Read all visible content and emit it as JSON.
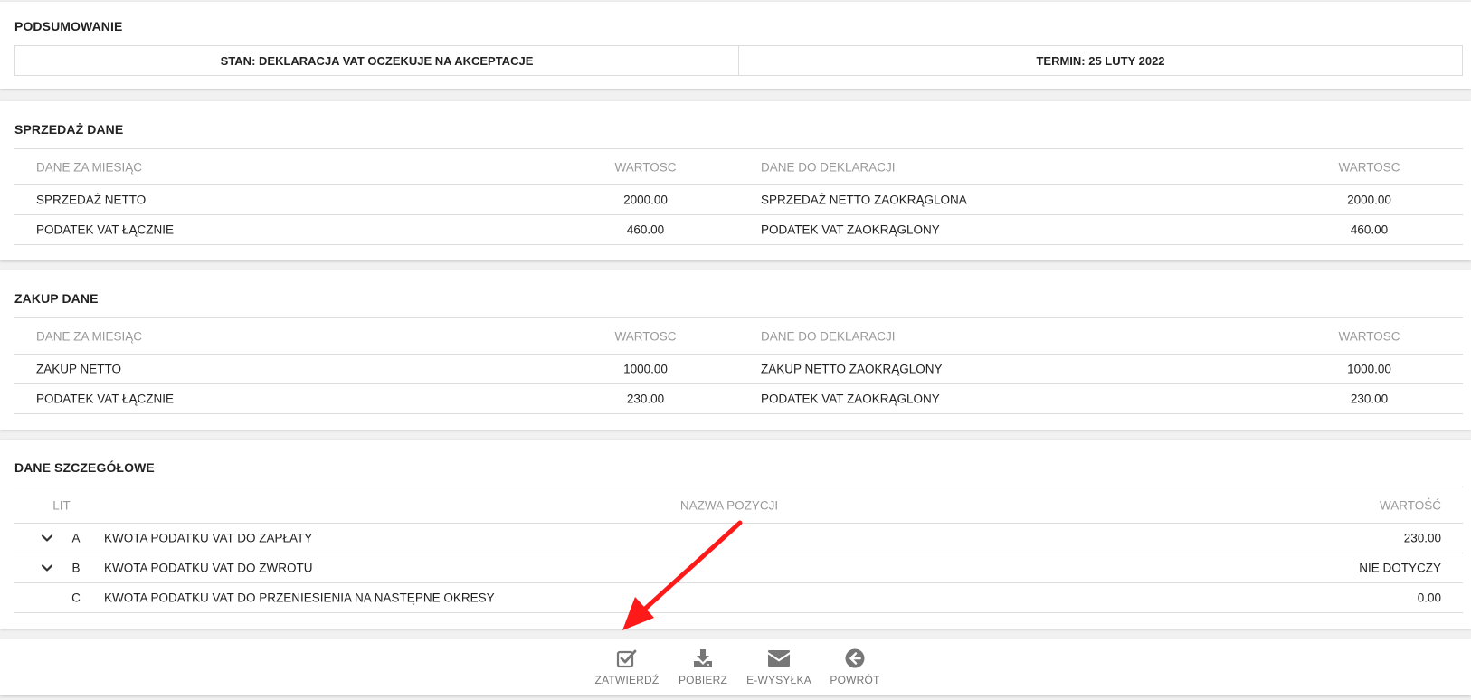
{
  "summary": {
    "title": "PODSUMOWANIE",
    "status": "STAN: DEKLARACJA VAT OCZEKUJE NA AKCEPTACJE",
    "deadline": "TERMIN: 25 LUTY 2022"
  },
  "sales": {
    "title": "SPRZEDAŻ DANE",
    "headers": [
      "DANE ZA MIESIĄC",
      "WARTOSC",
      "DANE DO DEKLARACJI",
      "WARTOSC"
    ],
    "rows": [
      [
        "SPRZEDAŻ NETTO",
        "2000.00",
        "SPRZEDAŻ NETTO ZAOKRĄGLONA",
        "2000.00"
      ],
      [
        "PODATEK VAT ŁĄCZNIE",
        "460.00",
        "PODATEK VAT ZAOKRĄGLONY",
        "460.00"
      ]
    ]
  },
  "purchase": {
    "title": "ZAKUP DANE",
    "headers": [
      "DANE ZA MIESIĄC",
      "WARTOSC",
      "DANE DO DEKLARACJI",
      "WARTOSC"
    ],
    "rows": [
      [
        "ZAKUP NETTO",
        "1000.00",
        "ZAKUP NETTO ZAOKRĄGLONY",
        "1000.00"
      ],
      [
        "PODATEK VAT ŁĄCZNIE",
        "230.00",
        "PODATEK VAT ZAOKRĄGLONY",
        "230.00"
      ]
    ]
  },
  "details": {
    "title": "DANE SZCZEGÓŁOWE",
    "headers": [
      "LIT",
      "NAZWA POZYCJI",
      "WARTOŚĆ"
    ],
    "rows": [
      {
        "lit": "A",
        "name": "KWOTA PODATKU VAT DO ZAPŁATY",
        "value": "230.00",
        "expandable": true
      },
      {
        "lit": "B",
        "name": "KWOTA PODATKU VAT DO ZWROTU",
        "value": "NIE DOTYCZY",
        "expandable": true
      },
      {
        "lit": "C",
        "name": "KWOTA PODATKU VAT DO PRZENIESIENIA NA NASTĘPNE OKRESY",
        "value": "0.00",
        "expandable": false
      }
    ]
  },
  "toolbar": {
    "approve": {
      "label": "ZATWIERDŹ",
      "icon": "check-square-icon"
    },
    "download": {
      "label": "POBIERZ",
      "icon": "download-icon"
    },
    "send": {
      "label": "E-WYSYŁKA",
      "icon": "envelope-icon"
    },
    "back": {
      "label": "POWRÓT",
      "icon": "arrow-circle-left-icon"
    }
  },
  "colors": {
    "annotation_arrow": "#ff1a1a",
    "muted_text": "#9a9a9a",
    "icon_gray": "#777777"
  }
}
